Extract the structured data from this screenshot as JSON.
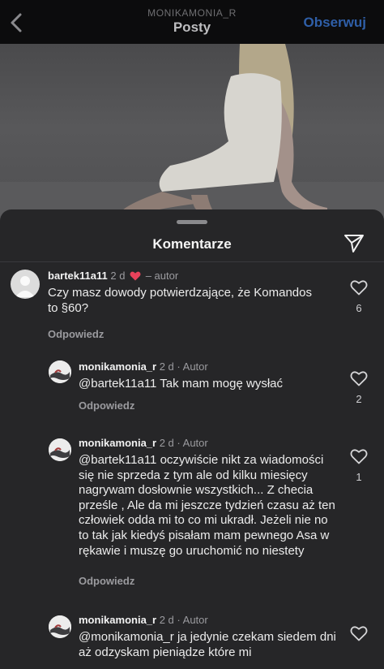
{
  "header": {
    "username": "MONIKAMONIA_R",
    "title": "Posty",
    "follow_label": "Obserwuj"
  },
  "sheet": {
    "title": "Komentarze"
  },
  "comments": [
    {
      "username": "bartek11a11",
      "time": "2 d",
      "author_tag": "– autor",
      "liked_by_author": true,
      "text": "Czy masz dowody potwierdzające, że Komandos to §60?",
      "reply": "Odpowiedz",
      "likes": "6"
    },
    {
      "username": "monikamonia_r",
      "time": "2 d",
      "author_tag": "· Autor",
      "text": "@bartek11a11 Tak mam mogę wysłać",
      "reply": "Odpowiedz",
      "likes": "2"
    },
    {
      "username": "monikamonia_r",
      "time": "2 d",
      "author_tag": "· Autor",
      "text": "@bartek11a11 oczywiście nikt za wiadomości się nie sprzeda z tym ale od kilku miesięcy nagrywam dosłownie wszystkich... Z checia prześle , Ale da mi jeszcze tydzień czasu aż ten człowiek odda mi to co mi ukradł. Jeżeli nie no to tak jak kiedyś pisałam mam pewnego Asa w rękawie i muszę go uruchomić no niestety",
      "reply": "Odpowiedz",
      "likes": "1"
    },
    {
      "username": "monikamonia_r",
      "time": "2 d",
      "author_tag": "· Autor",
      "text": "@monikamonia_r ja jedynie czekam siedem dni aż odzyskam pieniądze które mi"
    }
  ],
  "colors": {
    "follow": "#2f5fa8",
    "heart": "#e8425b",
    "sheet_bg": "#262628"
  }
}
